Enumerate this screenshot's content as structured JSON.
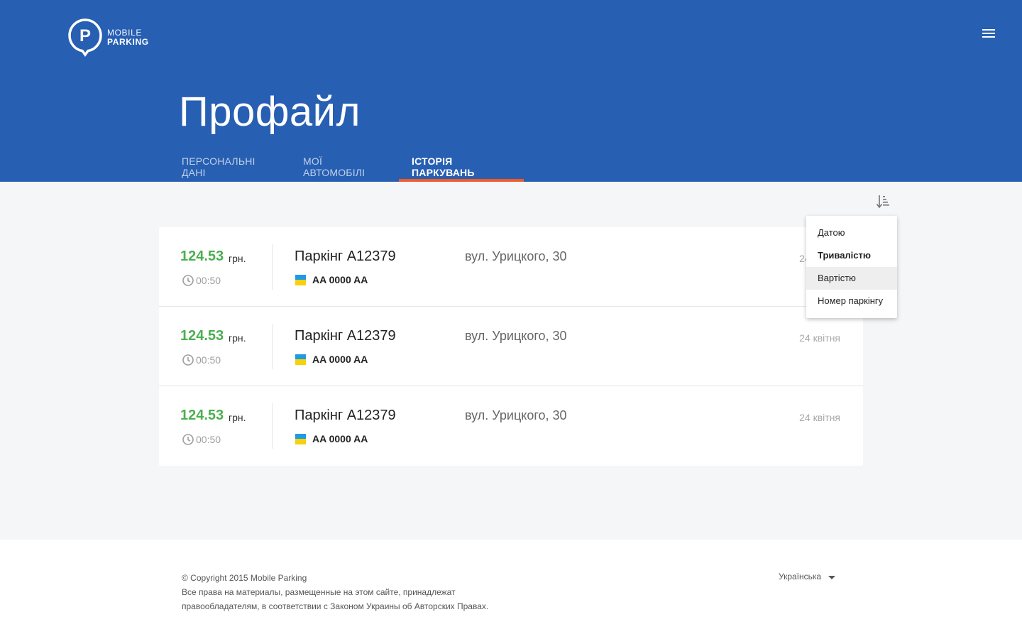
{
  "brand": {
    "line1": "MOBILE",
    "line2": "PARKING",
    "logo_letter": "P"
  },
  "header": {
    "title": "Профайл",
    "menu_icon": "hamburger-icon"
  },
  "tabs": [
    {
      "label": "Персональні дані",
      "active": false
    },
    {
      "label": "Мої автомобілі",
      "active": false
    },
    {
      "label": "Історія паркувань",
      "active": true
    }
  ],
  "sort": {
    "icon": "sort-icon",
    "options": [
      {
        "label": "Датою",
        "selected": false
      },
      {
        "label": "Тривалістю",
        "selected": true
      },
      {
        "label": "Вартістю",
        "selected": false,
        "hovered": true
      },
      {
        "label": "Номер паркінгу",
        "selected": false
      }
    ]
  },
  "history": [
    {
      "price": "124.53",
      "currency": "грн.",
      "duration": "00:50",
      "lot": "Паркінг A12379",
      "plate": "AA 0000 AA",
      "address": "вул. Урицкого, 30",
      "date": "24 квітня"
    },
    {
      "price": "124.53",
      "currency": "грн.",
      "duration": "00:50",
      "lot": "Паркінг A12379",
      "plate": "AA 0000 AA",
      "address": "вул. Урицкого, 30",
      "date": "24 квітня"
    },
    {
      "price": "124.53",
      "currency": "грн.",
      "duration": "00:50",
      "lot": "Паркінг A12379",
      "plate": "AA 0000 AA",
      "address": "вул. Урицкого, 30",
      "date": "24 квітня"
    }
  ],
  "footer": {
    "copyright": "© Copyright 2015 Mobile Parking",
    "rights_line1": "Все права на материалы, размещенные на этом сайте, принадлежат",
    "rights_line2": "правообладателям, в соответствии с Законом Украины об Авторских Правах.",
    "language": "Українська"
  },
  "colors": {
    "header_bg": "#275fb3",
    "tab_indicator": "#f15a2a",
    "price_green": "#4caf50",
    "flag_blue": "#1e9be6",
    "flag_yellow": "#f6d10c"
  }
}
